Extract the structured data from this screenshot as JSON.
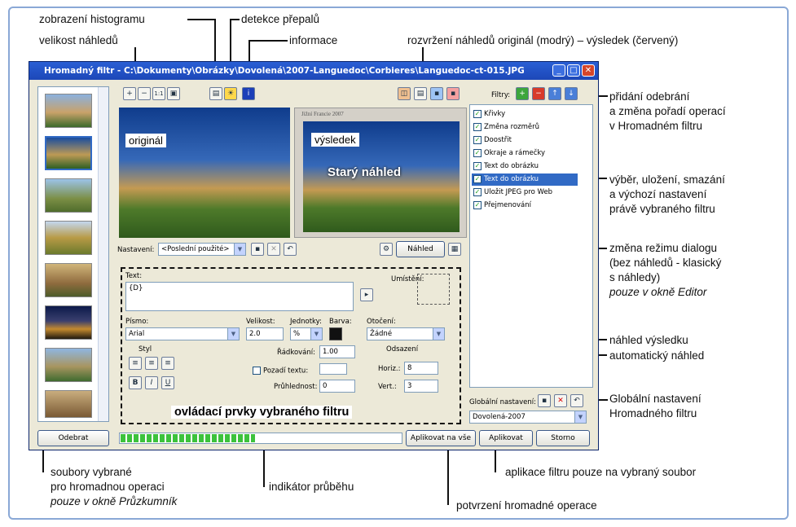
{
  "annotations": {
    "histogram": "zobrazení histogramu",
    "overexposure": "detekce přepalů",
    "preview_size": "velikost náhledů",
    "info": "informace",
    "layout": "rozvržení náhledů originál (modrý) – výsledek (červený)",
    "add_remove_1": "přidání odebrání",
    "add_remove_2": "a změna pořadí operací",
    "add_remove_3": "v Hromadném filtru",
    "select_save_1": "výběr, uložení, smazání",
    "select_save_2": "a výchozí nastavení",
    "select_save_3": "právě vybraného filtru",
    "mode_1": "změna režimu dialogu",
    "mode_2": "(bez náhledů - klasický",
    "mode_3": "s náhledy)",
    "mode_4": "pouze v okně Editor",
    "result_preview": "náhled výsledku",
    "auto_preview": "automatický náhled",
    "global_1": "Globální nastavení",
    "global_2": "Hromadného filtru",
    "files_1": "soubory vybrané",
    "files_2": "pro hromadnou operaci",
    "files_3": "pouze v okně Průzkumník",
    "progress": "indikátor průběhu",
    "apply_one": "aplikace filtru pouze na vybraný soubor",
    "confirm": "potvrzení hromadné operace",
    "controls": "ovládací prvky vybraného filtru"
  },
  "window": {
    "title": "Hromadný filtr - C:\\Dokumenty\\Obrázky\\Dovolená\\2007-Languedoc\\Corbieres\\Languedoc-ct-015.JPG",
    "original_label": "originál",
    "result_label": "výsledek",
    "stale_label": "Starý náhled",
    "result_caption": "Jižní Francie 2007",
    "filters_label": "Filtry:",
    "filters": [
      {
        "label": "Křivky",
        "checked": true
      },
      {
        "label": "Změna rozměrů",
        "checked": true
      },
      {
        "label": "Doostřit",
        "checked": true
      },
      {
        "label": "Okraje a rámečky",
        "checked": true
      },
      {
        "label": "Text do obrázku",
        "checked": true
      },
      {
        "label": "Text do obrázku",
        "checked": true,
        "selected": true
      },
      {
        "label": "Uložit JPEG pro Web",
        "checked": true
      },
      {
        "label": "Přejmenování",
        "checked": true
      }
    ],
    "settings_label": "Nastavení:",
    "settings_value": "<Poslední použité>",
    "preview_button": "Náhled",
    "text_label": "Text:",
    "text_value": "{D}",
    "position_label": "Umístění:",
    "font_label": "Písmo:",
    "font_value": "Arial",
    "size_label": "Velikost:",
    "size_value": "2.0",
    "units_label": "Jednotky:",
    "units_value": "%",
    "color_label": "Barva:",
    "rotation_label": "Otočení:",
    "rotation_value": "Žádné",
    "style_label": "Styl",
    "line_spacing_label": "Řádkování:",
    "line_spacing_value": "1.00",
    "background_label": "Pozadí textu:",
    "opacity_label": "Průhlednost:",
    "opacity_value": "0",
    "offset_label": "Odsazení",
    "horiz_label": "Horiz.:",
    "horiz_value": "8",
    "vert_label": "Vert.:",
    "vert_value": "3",
    "global_settings_label": "Globální nastavení:",
    "global_settings_value": "Dovolená-2007",
    "remove_button": "Odebrat",
    "apply_all_button": "Aplikovat na vše",
    "apply_button": "Aplikovat",
    "cancel_button": "Storno",
    "progress": 0.48
  }
}
